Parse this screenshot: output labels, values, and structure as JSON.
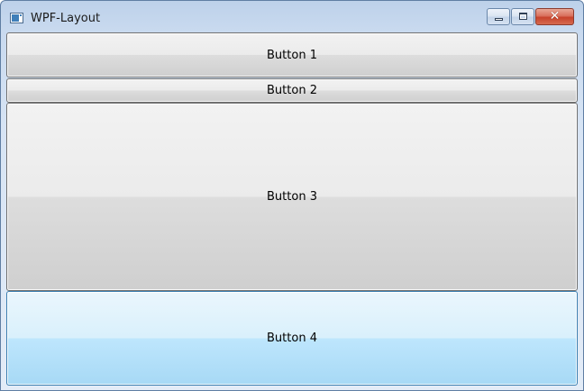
{
  "window": {
    "title": "WPF-Layout",
    "icon": "app-window-icon",
    "caption_buttons": {
      "minimize_icon": "minimize-icon",
      "maximize_icon": "maximize-icon",
      "close_icon": "close-icon",
      "close_glyph": "✕"
    }
  },
  "buttons": [
    {
      "label": "Button 1"
    },
    {
      "label": "Button 2"
    },
    {
      "label": "Button 3"
    },
    {
      "label": "Button 4",
      "state": "hover"
    }
  ],
  "colors": {
    "frame": "#c9daef",
    "close_button": "#c7432b",
    "hover_button": "#bee6fd",
    "button_face": "#ebebeb"
  }
}
